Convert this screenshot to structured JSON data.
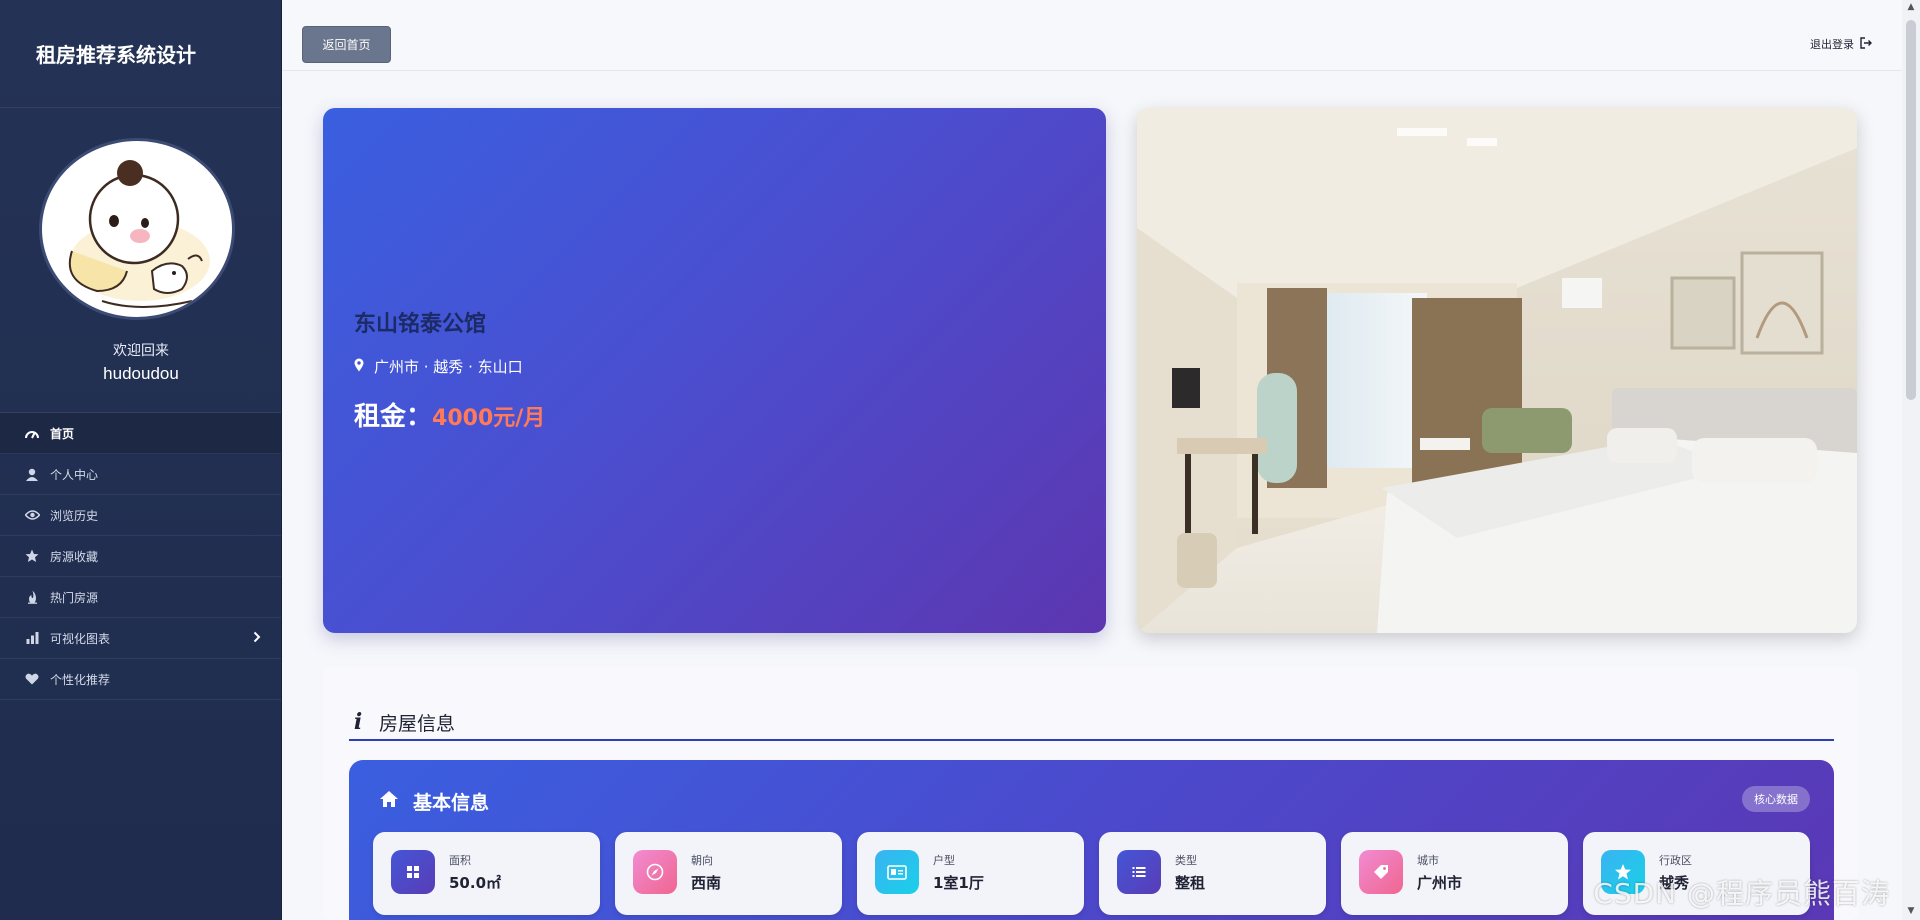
{
  "sidebar": {
    "brand": "租房推荐系统设计",
    "welcome": "欢迎回来",
    "username": "hudoudou",
    "items": [
      {
        "label": "首页",
        "icon": "dashboard-icon",
        "active": true
      },
      {
        "label": "个人中心",
        "icon": "user-icon"
      },
      {
        "label": "浏览历史",
        "icon": "eye-icon"
      },
      {
        "label": "房源收藏",
        "icon": "star-icon"
      },
      {
        "label": "热门房源",
        "icon": "fire-icon"
      },
      {
        "label": "可视化图表",
        "icon": "bar-chart-icon",
        "has_submenu": true
      },
      {
        "label": "个性化推荐",
        "icon": "heart-icon"
      }
    ]
  },
  "topbar": {
    "back_label": "返回首页",
    "logout_label": "退出登录"
  },
  "hero": {
    "title": "东山铭泰公馆",
    "location": "广州市 · 越秀 · 东山口",
    "rent_label": "租金：",
    "rent_value": "4000元/月"
  },
  "info": {
    "section_title": "房屋信息",
    "basic_title": "基本信息",
    "core_badge": "核心数据",
    "stats": [
      {
        "label": "面积",
        "value": "50.0㎡",
        "icon": "grid-icon"
      },
      {
        "label": "朝向",
        "value": "西南",
        "icon": "compass-icon"
      },
      {
        "label": "户型",
        "value": "1室1厅",
        "icon": "id-card-icon"
      },
      {
        "label": "类型",
        "value": "整租",
        "icon": "list-icon"
      },
      {
        "label": "城市",
        "value": "广州市",
        "icon": "tag-icon"
      },
      {
        "label": "行政区",
        "value": "越秀",
        "icon": "star-badge-icon"
      }
    ]
  },
  "watermark": "CSDN @程序员熊百涛",
  "colors": {
    "sidebar_bg": "#243256",
    "accent_blue": "#3a5fe0",
    "accent_purple": "#5d36b0",
    "rent_color": "#ff7a59"
  }
}
